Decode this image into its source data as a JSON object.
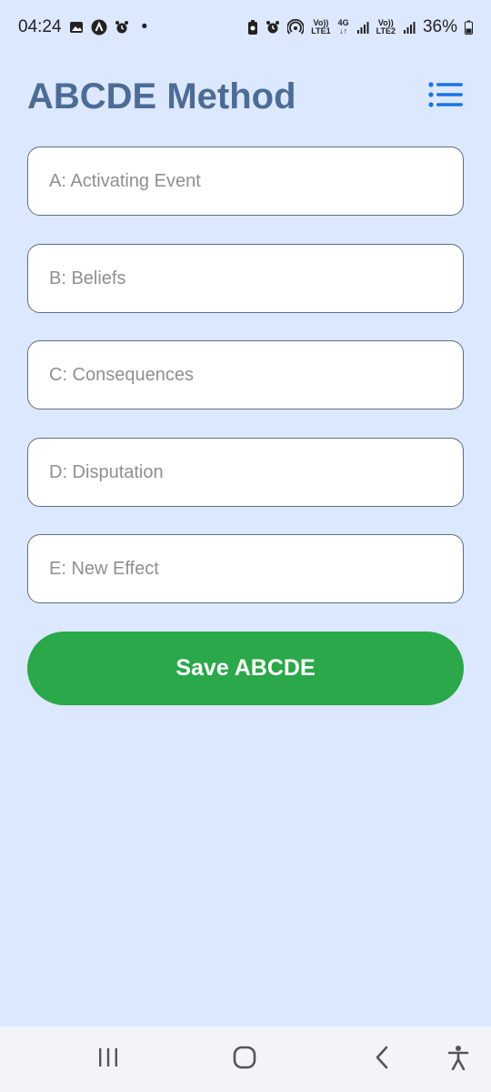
{
  "status_bar": {
    "time": "04:24",
    "dot": "•",
    "volte1_top": "Vo))",
    "volte1_bottom": "LTE1",
    "network_top": "4G",
    "network_bottom": "↓↑",
    "volte2_top": "Vo))",
    "volte2_bottom": "LTE2",
    "battery": "36%",
    "left_icons": [
      "gallery-icon",
      "app-icon",
      "alarm-icon"
    ],
    "right_icons": [
      "battery-saver-icon",
      "alarm-icon",
      "hotspot-icon",
      "signal-icon",
      "battery-icon"
    ]
  },
  "header": {
    "title": "ABCDE Method",
    "menu_icon": "list-menu-icon"
  },
  "form": {
    "a_placeholder": "A: Activating Event",
    "b_placeholder": "B: Beliefs",
    "c_placeholder": "C: Consequences",
    "d_placeholder": "D: Disputation",
    "e_placeholder": "E: New Effect",
    "save_label": "Save ABCDE"
  },
  "nav_bar": {
    "items": [
      "recents-icon",
      "home-icon",
      "back-icon",
      "accessibility-icon"
    ]
  },
  "colors": {
    "background": "#dce8fd",
    "title": "#4d6c95",
    "accent_blue": "#1a73e8",
    "save_green": "#2aa84a",
    "field_border": "#5e6e84"
  }
}
